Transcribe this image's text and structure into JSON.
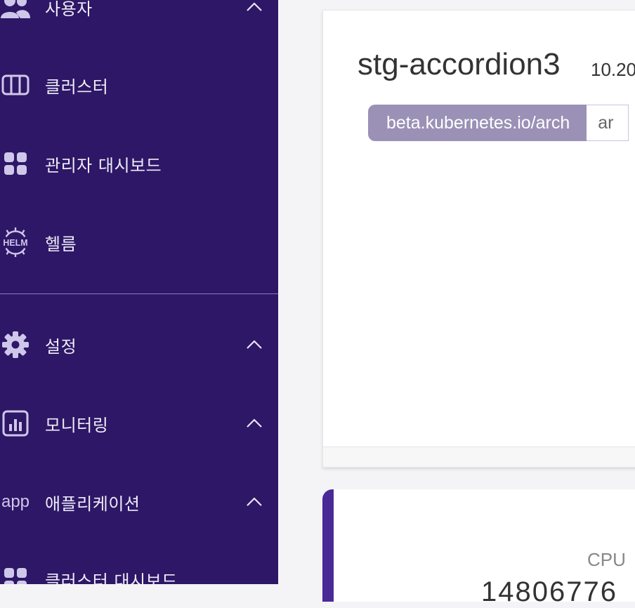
{
  "sidebar": {
    "items": [
      {
        "label": "사용자",
        "icon": "users-icon",
        "expandable": true
      },
      {
        "label": "클러스터",
        "icon": "cluster-icon",
        "expandable": false
      },
      {
        "label": "관리자 대시보드",
        "icon": "dashboard-icon",
        "expandable": false
      },
      {
        "label": "헬름",
        "icon": "helm-icon",
        "expandable": false
      },
      {
        "label": "설정",
        "icon": "gear-icon",
        "expandable": true
      },
      {
        "label": "모니터링",
        "icon": "monitoring-icon",
        "expandable": true
      },
      {
        "label": "애플리케이션",
        "icon": "app-icon",
        "icon_text": "app",
        "expandable": true
      },
      {
        "label": "클러스터 대시보드",
        "icon": "dashboard-icon",
        "expandable": false
      }
    ],
    "helm_icon_text": "HELM"
  },
  "node_card": {
    "name": "stg-accordion3",
    "ip": "10.20",
    "label_key": "beta.kubernetes.io/arch",
    "label_value": "ar"
  },
  "stat_card": {
    "label": "CPU",
    "value": "14806776"
  },
  "colors": {
    "sidebar_bg": "#2d1766",
    "accent": "#4a2a96",
    "chip_bg": "#9b91b7"
  }
}
